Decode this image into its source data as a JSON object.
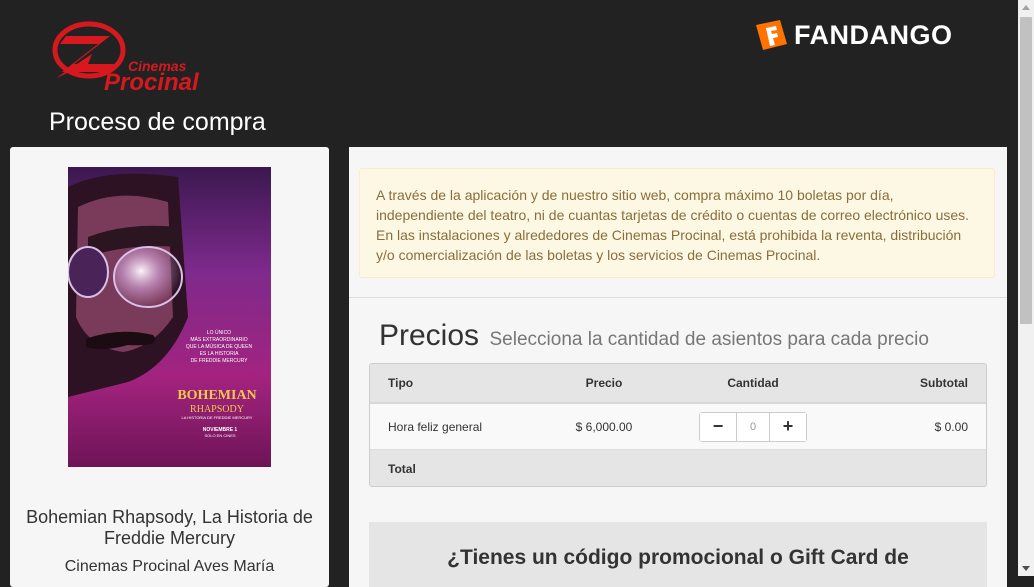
{
  "header": {
    "logo_line1": "Cinemas",
    "logo_line2": "Procinal",
    "page_title": "Proceso de compra",
    "partner_logo": "FANDANGO"
  },
  "movie": {
    "title": "Bohemian Rhapsody, La Historia de Freddie Mercury",
    "cinema": "Cinemas Procinal Aves María",
    "poster": {
      "line1": "LO ÚNICO",
      "line2": "MÁS EXTRAORDINARIO",
      "line3": "QUE LA MÚSICA DE QUEEN",
      "line4": "ES LA HISTORIA",
      "line5": "DE FREDDIE MERCURY",
      "name1": "BOHEMIAN",
      "name2": "RHAPSODY",
      "tagline": "LA HISTORIA DE FREDDIE MERCURY",
      "release1": "NOVIEMBRE 1",
      "release2": "SOLO EN CINES"
    }
  },
  "notice": {
    "text": "A través de la aplicación y de nuestro sitio web, compra máximo 10 boletas por día, independiente del teatro, ni de cuantas tarjetas de crédito o cuentas de correo electrónico uses. En las instalaciones y alrededores de Cinemas Procinal, está prohibida la reventa, distribución y/o comercialización de las boletas y los servicios de Cinemas Procinal."
  },
  "prices": {
    "title": "Precios",
    "subtitle": "Selecciona la cantidad de asientos para cada precio",
    "columns": {
      "type": "Tipo",
      "price": "Precio",
      "quantity": "Cantidad",
      "subtotal": "Subtotal"
    },
    "rows": [
      {
        "type": "Hora feliz general",
        "price": "$ 6,000.00",
        "quantity": "0",
        "subtotal": "$ 0.00"
      }
    ],
    "total_label": "Total",
    "minus_symbol": "−",
    "plus_symbol": "+"
  },
  "promo": {
    "title": "¿Tienes un código promocional o Gift Card de"
  },
  "colors": {
    "brand_red": "#d7191f",
    "fandango_orange": "#ff7300",
    "header_bg": "#222222",
    "notice_bg": "#fcf8e3",
    "notice_text": "#8a6d3b"
  },
  "icons": {
    "minus": "minus-icon",
    "plus": "plus-icon",
    "brand": "cinemas-procinal-logo",
    "partner": "fandango-logo"
  }
}
